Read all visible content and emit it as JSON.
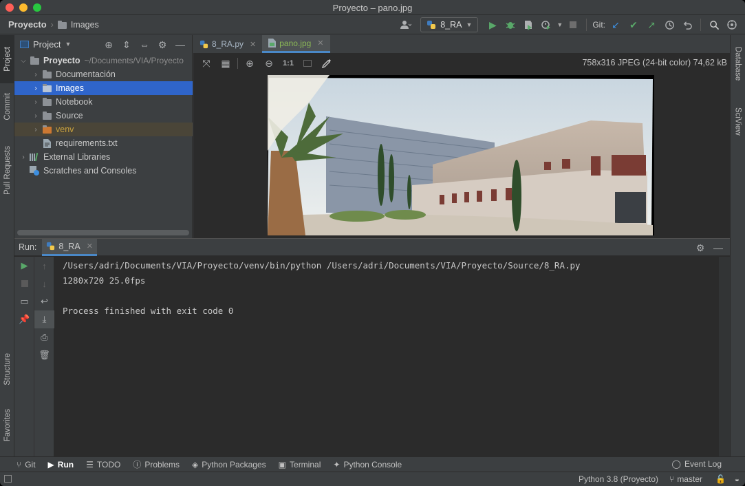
{
  "window": {
    "title": "Proyecto – pano.jpg"
  },
  "navbar": {
    "project": "Proyecto",
    "folder": "Images",
    "run_config": "8_RA",
    "git_label": "Git:"
  },
  "left_tabs": {
    "project": "Project",
    "commit": "Commit",
    "pull_requests": "Pull Requests",
    "structure": "Structure",
    "favorites": "Favorites"
  },
  "right_tabs": {
    "database": "Database",
    "sciview": "SciView"
  },
  "project_panel": {
    "header": "Project",
    "root_name": "Proyecto",
    "root_path": "~/Documents/VIA/Proyecto",
    "items": [
      {
        "label": "Documentación"
      },
      {
        "label": "Images"
      },
      {
        "label": "Notebook"
      },
      {
        "label": "Source"
      },
      {
        "label": "venv"
      },
      {
        "label": "requirements.txt"
      },
      {
        "label": "External Libraries"
      },
      {
        "label": "Scratches and Consoles"
      }
    ]
  },
  "editor": {
    "tabs": [
      {
        "label": "8_RA.py"
      },
      {
        "label": "pano.jpg"
      }
    ],
    "zoom_label": "1:1",
    "image_info": "758x316 JPEG (24-bit color) 74,62 kB"
  },
  "run": {
    "label": "Run:",
    "tab": "8_RA",
    "console_lines": [
      "/Users/adri/Documents/VIA/Proyecto/venv/bin/python /Users/adri/Documents/VIA/Proyecto/Source/8_RA.py",
      "1280x720 25.0fps",
      "",
      "Process finished with exit code 0"
    ]
  },
  "bottom_tabs": {
    "git": "Git",
    "run": "Run",
    "todo": "TODO",
    "problems": "Problems",
    "python_packages": "Python Packages",
    "terminal": "Terminal",
    "python_console": "Python Console",
    "event_log": "Event Log"
  },
  "status": {
    "interpreter": "Python 3.8 (Proyecto)",
    "branch": "master"
  },
  "colors": {
    "selection": "#2f65ca",
    "accent": "#4a88c7",
    "run_green": "#59a869",
    "venv_orange": "#cc7832"
  }
}
